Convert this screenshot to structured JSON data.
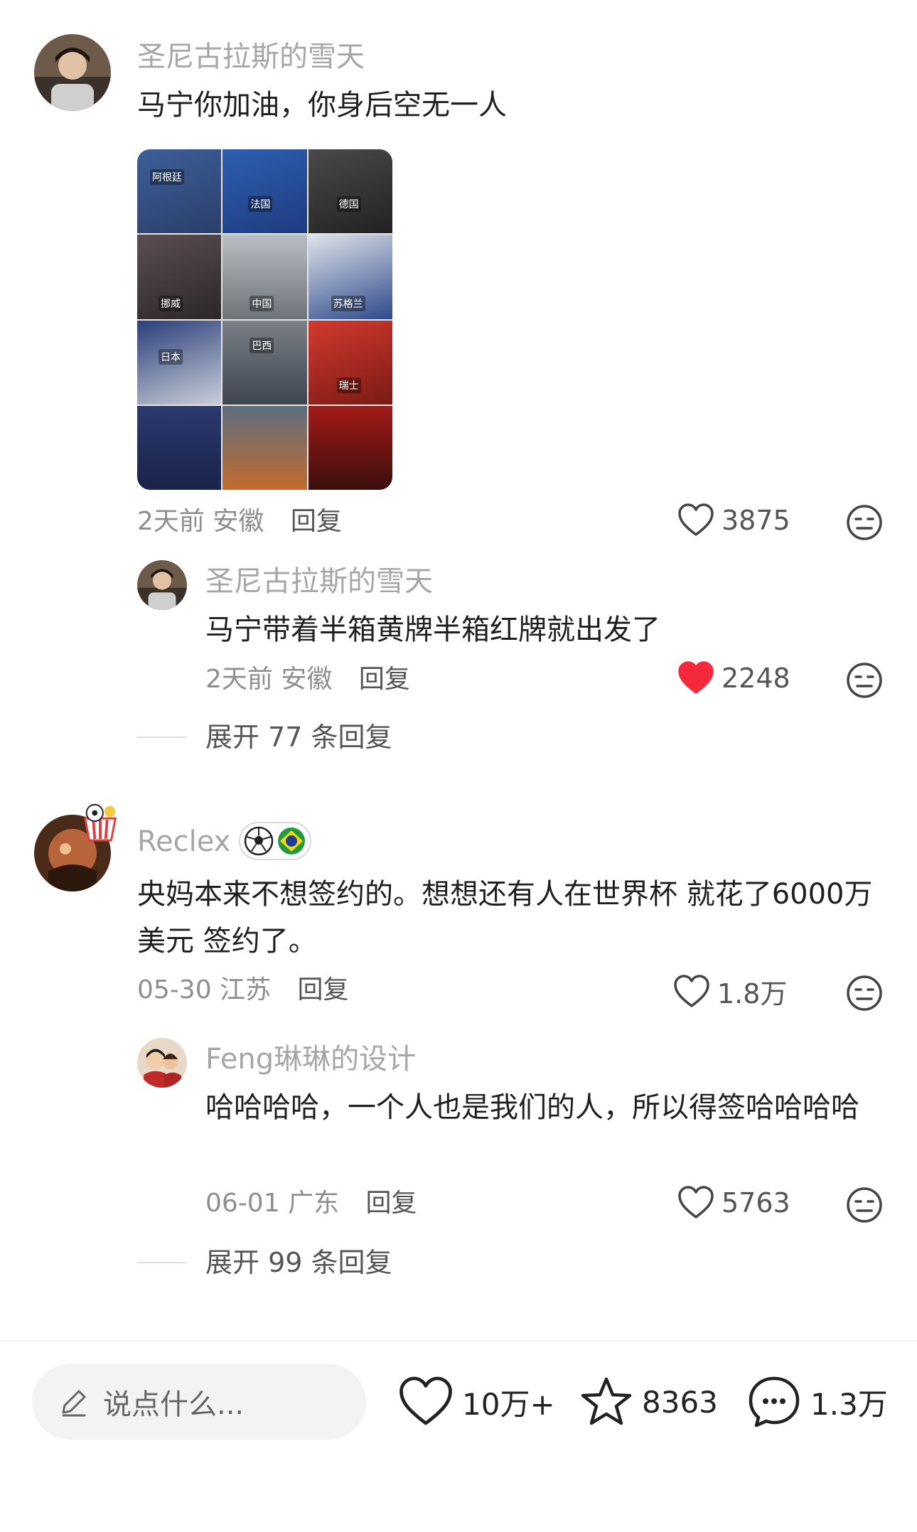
{
  "comments": [
    {
      "username": "圣尼古拉斯的雪天",
      "text": "马宁你加油，你身后空无一人",
      "date": "2天前",
      "location": "安徽",
      "reply_label": "回复",
      "likes": "3875",
      "liked": false,
      "image_labels": [
        "阿根廷",
        "法国",
        "德国",
        "挪威",
        "中国",
        "苏格兰",
        "日本",
        "巴西",
        "瑞士"
      ],
      "replies": [
        {
          "username": "圣尼古拉斯的雪天",
          "text": "马宁带着半箱黄牌半箱红牌就出发了",
          "date": "2天前",
          "location": "安徽",
          "reply_label": "回复",
          "likes": "2248",
          "liked": true
        }
      ],
      "expand_label": "展开 77 条回复"
    },
    {
      "username": "Reclex",
      "text": "央妈本来不想签约的。想想还有人在世界杯 就花了6000万美元 签约了。",
      "date": "05-30",
      "location": "江苏",
      "reply_label": "回复",
      "likes": "1.8万",
      "liked": false,
      "replies": [
        {
          "username": "Feng琳琳的设计",
          "text": "哈哈哈哈，一个人也是我们的人，所以得签哈哈哈哈",
          "date": "06-01",
          "location": "广东",
          "reply_label": "回复",
          "likes": "5763",
          "liked": false
        }
      ],
      "expand_label": "展开 99 条回复"
    }
  ],
  "bottom_bar": {
    "input_placeholder": "说点什么...",
    "likes": "10万+",
    "favorites": "8363",
    "comments": "1.3万"
  },
  "colors": {
    "liked_heart": "#f5283c",
    "username_gray": "#a6a6a6",
    "text": "#1f1f1f"
  },
  "icons": [
    "heart-icon",
    "dislike-face-icon",
    "pencil-icon",
    "star-icon",
    "comment-bubble-icon",
    "soccer-ball-icon",
    "brazil-flag-icon"
  ]
}
